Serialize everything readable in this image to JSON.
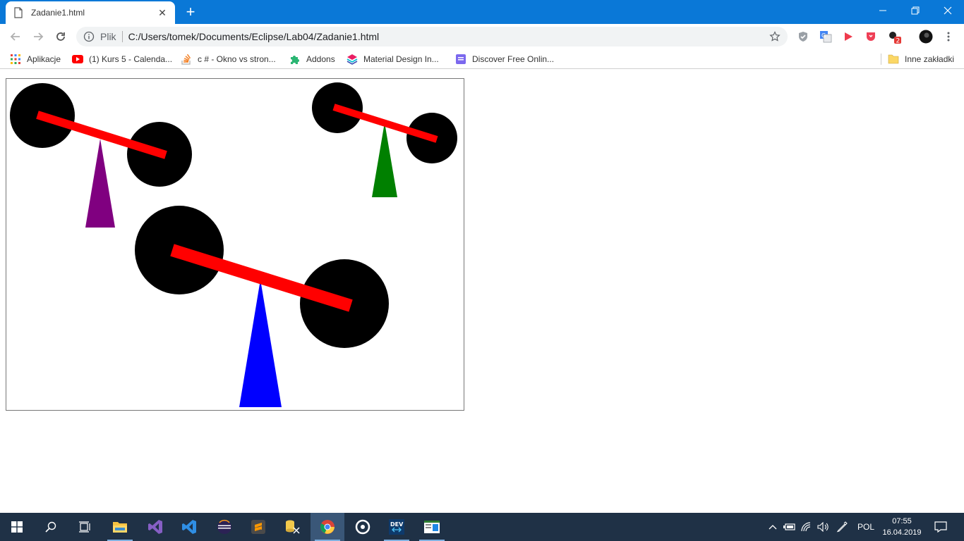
{
  "browser": {
    "tab": {
      "title": "Zadanie1.html",
      "close": "✕"
    },
    "new_tab": "+",
    "window_controls": {
      "minimize": "—",
      "restore": "❐",
      "close": "✕"
    },
    "address": {
      "scheme_label": "Plik",
      "url": "C:/Users/tomek/Documents/Eclipse/Lab04/Zadanie1.html"
    },
    "extension_badge": "2",
    "bookmarks": [
      {
        "label": "Aplikacje",
        "icon": "apps-grid-icon"
      },
      {
        "label": "(1) Kurs 5 - Calenda...",
        "icon": "youtube-icon"
      },
      {
        "label": "c # - Okno vs stron...",
        "icon": "stackoverflow-icon"
      },
      {
        "label": "Addons",
        "icon": "puzzle-icon"
      },
      {
        "label": "Material Design In...",
        "icon": "layers-icon"
      },
      {
        "label": "Discover Free Onlin...",
        "icon": "purple-square-icon"
      }
    ],
    "other_bookmarks": "Inne zakładki"
  },
  "scene": {
    "colors": {
      "weights": "#000000",
      "beams": "#ff0000",
      "fulcrum_small": "#800080",
      "fulcrum_right": "#008000",
      "fulcrum_large": "#0000ff",
      "canvas_border": "#777777"
    }
  },
  "taskbar": {
    "language": "POL",
    "time": "07:55",
    "date": "16.04.2019"
  }
}
